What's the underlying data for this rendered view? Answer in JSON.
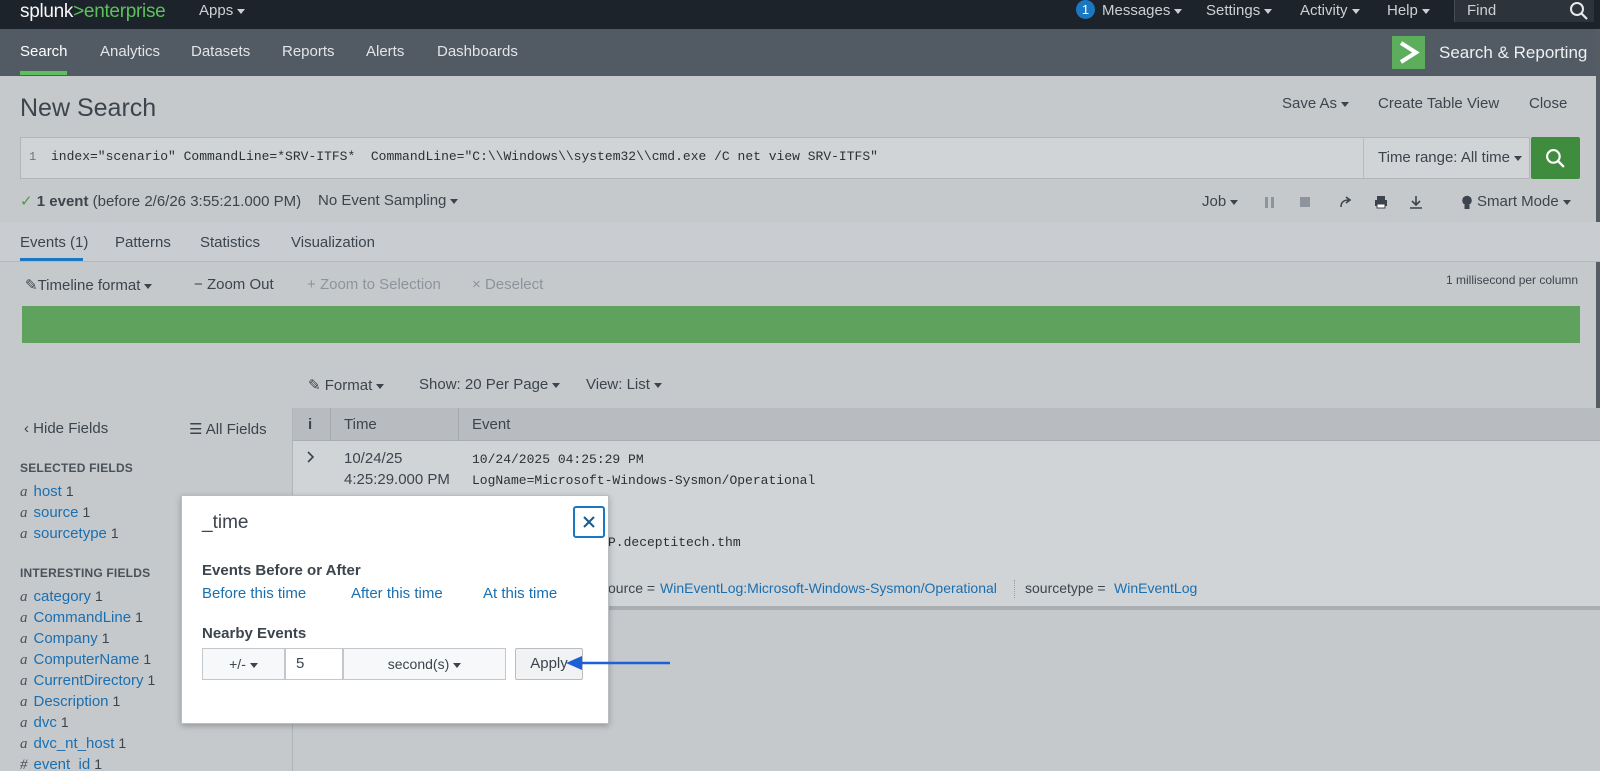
{
  "topbar": {
    "logo_main": "splunk",
    "logo_gt": ">",
    "logo_product": "enterprise",
    "apps": "Apps",
    "messages_count": "1",
    "messages": "Messages",
    "settings": "Settings",
    "activity": "Activity",
    "help": "Help",
    "find": "Find"
  },
  "appbar": {
    "tabs": [
      "Search",
      "Analytics",
      "Datasets",
      "Reports",
      "Alerts",
      "Dashboards"
    ],
    "app_name": "Search & Reporting",
    "accent": "#5cc05c"
  },
  "page": {
    "title": "New Search",
    "save_as": "Save As",
    "create_table_view": "Create Table View",
    "close": "Close"
  },
  "search": {
    "line_number": "1",
    "query": "index=\"scenario\" CommandLine=*SRV-ITFS*  CommandLine=\"C:\\\\Windows\\\\system32\\\\cmd.exe /C net view SRV-ITFS\"",
    "time_range": "Time range: All time"
  },
  "status": {
    "check": "✓",
    "count": "1 event",
    "before": "(before 2/6/26 3:55:21.000 PM)",
    "sampling": "No Event Sampling",
    "job": "Job",
    "mode": "Smart Mode"
  },
  "result_tabs": [
    "Events (1)",
    "Patterns",
    "Statistics",
    "Visualization"
  ],
  "timeline": {
    "format": "Timeline format",
    "zoom_out": "Zoom Out",
    "zoom_selection": "Zoom to Selection",
    "deselect": "Deselect",
    "resolution": "1 millisecond per column",
    "bar_color": "#5ea25e"
  },
  "list_controls": {
    "format": "Format",
    "show": "Show: 20 Per Page",
    "view": "View: List"
  },
  "sidebar": {
    "hide_fields": "Hide Fields",
    "all_fields": "All Fields",
    "selected_heading": "SELECTED FIELDS",
    "selected": [
      {
        "type": "a",
        "name": "host",
        "count": "1"
      },
      {
        "type": "a",
        "name": "source",
        "count": "1"
      },
      {
        "type": "a",
        "name": "sourcetype",
        "count": "1"
      }
    ],
    "interesting_heading": "INTERESTING FIELDS",
    "interesting": [
      {
        "type": "a",
        "name": "category",
        "count": "1"
      },
      {
        "type": "a",
        "name": "CommandLine",
        "count": "1"
      },
      {
        "type": "a",
        "name": "Company",
        "count": "1"
      },
      {
        "type": "a",
        "name": "ComputerName",
        "count": "1"
      },
      {
        "type": "a",
        "name": "CurrentDirectory",
        "count": "1"
      },
      {
        "type": "a",
        "name": "Description",
        "count": "1"
      },
      {
        "type": "a",
        "name": "dvc",
        "count": "1"
      },
      {
        "type": "a",
        "name": "dvc_nt_host",
        "count": "1"
      },
      {
        "type": "#",
        "name": "event_id",
        "count": "1"
      }
    ]
  },
  "table": {
    "col_info": "i",
    "col_time": "Time",
    "col_event": "Event",
    "row": {
      "date": "10/24/25",
      "time": "4:25:29.000 PM",
      "line1": "10/24/2025 04:25:29 PM",
      "line2": "LogName=Microsoft-Windows-Sysmon/Operational",
      "line_partial": "P.deceptitech.thm",
      "source_label": "ource =",
      "source_value": "WinEventLog:Microsoft-Windows-Sysmon/Operational",
      "sourcetype_label": "sourcetype =",
      "sourcetype_value": "WinEventLog"
    }
  },
  "popup": {
    "title": "_time",
    "section1": "Events Before or After",
    "before": "Before this time",
    "after": "After this time",
    "at": "At this time",
    "section2": "Nearby Events",
    "plusminus": "+/-",
    "number": "5",
    "unit": "second(s)",
    "apply": "Apply"
  }
}
